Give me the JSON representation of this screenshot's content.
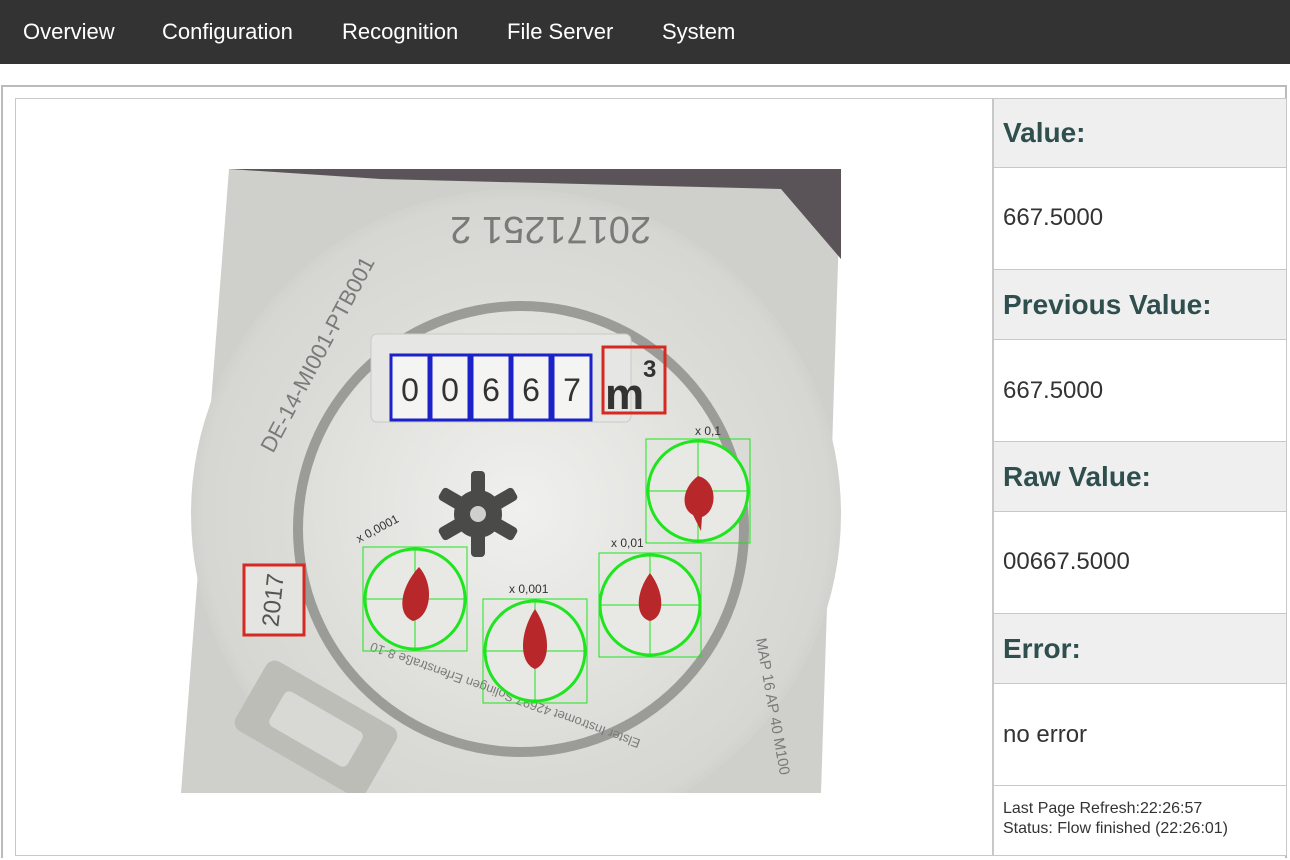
{
  "nav": {
    "items": [
      "Overview",
      "Configuration",
      "Recognition",
      "File Server",
      "System"
    ]
  },
  "meter_image": {
    "digit_readings": [
      "0",
      "0",
      "6",
      "6",
      "7"
    ],
    "unit_label": "m",
    "unit_exponent": "3",
    "year_label": "2017",
    "serial_label": "20171251 2",
    "model_label": "DE-14-MI001-PTB001",
    "dial_labels": [
      "x 0,1",
      "x 0,01",
      "x 0,001",
      "x 0,0001"
    ],
    "side_text": "MAP 16 AP 40 M100",
    "maker_text": "Elster Instromet 42697 Solingen Erfenstraße 8-10",
    "colors": {
      "digit_box": "#1b22c8",
      "unit_box": "#d42a22",
      "dial_ring": "#1ee51e",
      "needle": "#b8272a"
    }
  },
  "panel": {
    "value_header": "Value:",
    "value": "667.5000",
    "previous_header": "Previous Value:",
    "previous": "667.5000",
    "raw_header": "Raw Value:",
    "raw": "00667.5000",
    "error_header": "Error:",
    "error": "no error",
    "refresh": "Last Page Refresh:22:26:57",
    "status": "Status: Flow finished (22:26:01)"
  }
}
